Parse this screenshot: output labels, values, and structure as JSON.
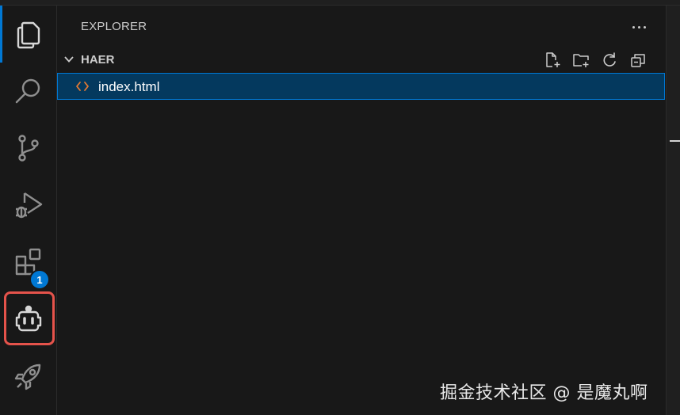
{
  "sidebar": {
    "title": "EXPLORER",
    "more_actions": "···",
    "folder": {
      "name": "HAER",
      "actions": [
        "new-file",
        "new-folder",
        "refresh",
        "collapse-all"
      ]
    },
    "files": [
      {
        "name": "index.html",
        "icon": "html-code-icon",
        "selected": true
      }
    ]
  },
  "activity_bar": {
    "items": [
      {
        "name": "explorer",
        "icon": "files-icon",
        "active": true
      },
      {
        "name": "search",
        "icon": "search-icon"
      },
      {
        "name": "source-control",
        "icon": "source-control-icon"
      },
      {
        "name": "run-and-debug",
        "icon": "run-debug-icon"
      },
      {
        "name": "extensions",
        "icon": "extensions-icon",
        "badge": "1"
      },
      {
        "name": "copilot",
        "icon": "robot-icon",
        "highlighted": true
      },
      {
        "name": "deploy",
        "icon": "rocket-icon"
      }
    ]
  },
  "colors": {
    "accent": "#0078d4",
    "selection": "#04395e",
    "highlight": "#e5534b",
    "file_icon": "#e37933"
  },
  "watermark": "掘金技术社区 @ 是魔丸啊"
}
